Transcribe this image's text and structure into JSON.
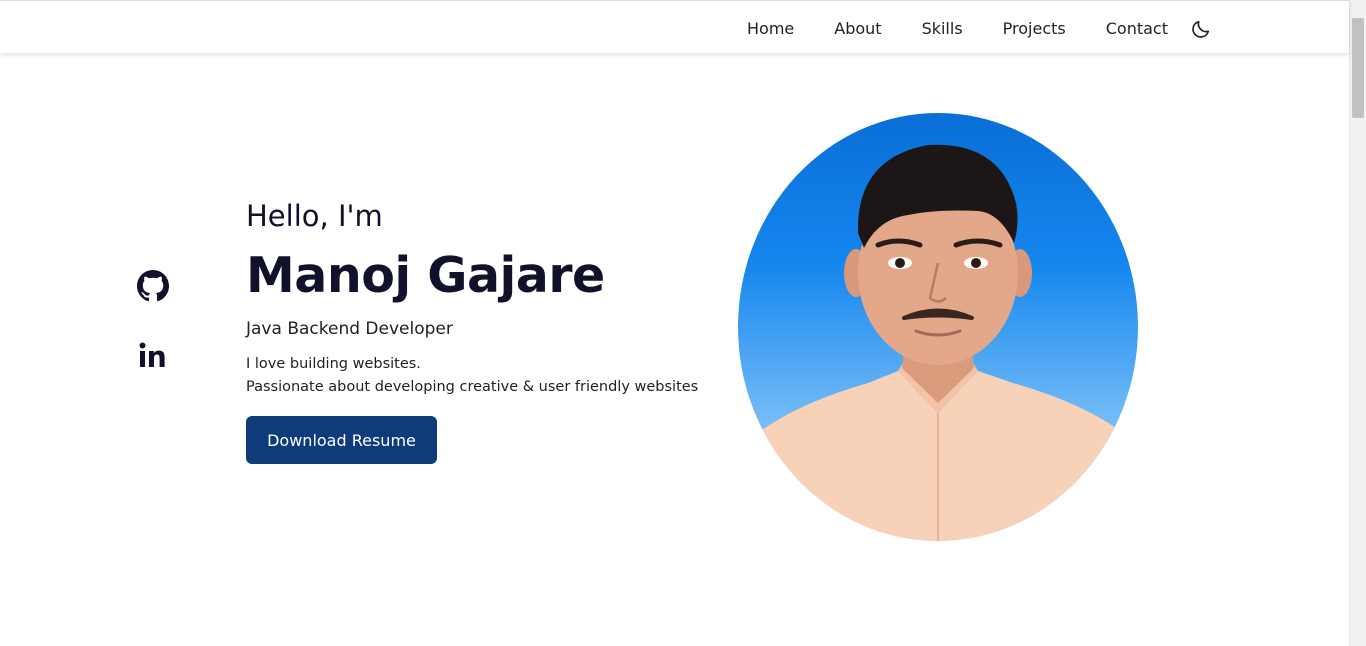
{
  "nav": {
    "items": [
      "Home",
      "About",
      "Skills",
      "Projects",
      "Contact"
    ],
    "theme_toggle_icon": "moon-icon"
  },
  "social": {
    "icons": [
      "github-icon",
      "linkedin-icon"
    ]
  },
  "hero": {
    "greeting": "Hello, I'm",
    "name": "Manoj Gajare",
    "role": "Java Backend Developer",
    "description_line1": "I love building websites.",
    "description_line2": "Passionate about developing creative & user friendly websites",
    "cta_label": "Download Resume"
  },
  "colors": {
    "primary_button": "#0e3b7a",
    "heading_text": "#11112b",
    "avatar_background": "#1486ee"
  }
}
